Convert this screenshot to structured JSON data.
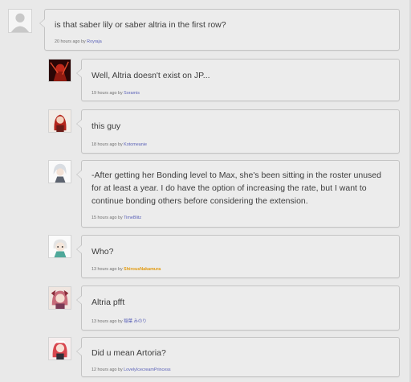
{
  "comments": [
    {
      "text": "is that saber lily or saber altria in the first row?",
      "time": "20 hours ago by",
      "user": "Royraja"
    },
    {
      "text": "Well, Altria doesn't exist on JP...",
      "time": "19 hours ago by",
      "user": "Soramis"
    },
    {
      "text": "this guy",
      "time": "18 hours ago by",
      "user": "Kotomeanie"
    },
    {
      "text": "-After getting her Bonding level to Max, she's been sitting in the roster unused for at least a year. I do have the option of increasing the rate, but I want to continue bonding others before considering the extension.",
      "time": "15 hours ago by",
      "user": "TimeBlitz"
    },
    {
      "text": "Who?",
      "time": "13 hours ago by",
      "user": "ShirousNakamura"
    },
    {
      "text": "Altria pfft",
      "time": "13 hours ago by",
      "user": "稲葉 みのり"
    },
    {
      "text": "Did u mean Artoria?",
      "time": "12 hours ago by",
      "user": "LovelyIcecreamPrincess"
    }
  ],
  "colors": {
    "background": "#e9e9e9",
    "bubble": "#ececec",
    "bubble_border": "#c4c4c4",
    "username_link": "#5b62b8",
    "username_highlight": "#e19a10"
  },
  "avatars": [
    "default-user-icon",
    "red-dark-character-icon",
    "red-haired-girl-icon",
    "white-haired-character-icon",
    "green-haired-chibi-icon",
    "pink-haired-girl-icon",
    "red-maid-girl-icon"
  ]
}
